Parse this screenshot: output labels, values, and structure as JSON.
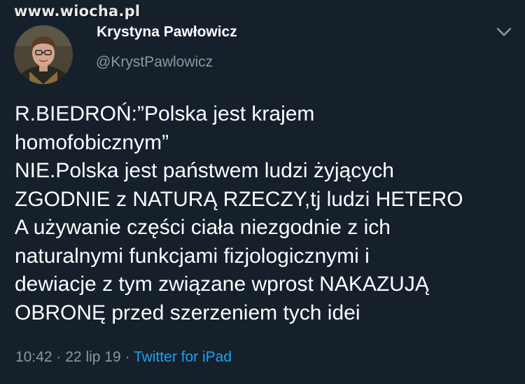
{
  "watermark": "www.wiocha.pl",
  "author": {
    "name": "Krystyna Pawłowicz",
    "handle": "@KrystPawlowicz"
  },
  "tweet": {
    "lines": [
      "R.BIEDROŃ:”Polska jest krajem",
      "homofobicznym”",
      "NIE.Polska jest państwem ludzi żyjących",
      "ZGODNIE z NATURĄ RZECZY,tj ludzi HETERO",
      "A używanie części ciała niezgodnie z ich",
      "naturalnymi funkcjami fizjologicznymi i",
      "dewiacje z tym związane wprost NAKAZUJĄ",
      "OBRONĘ przed szerzeniem tych idei"
    ]
  },
  "meta": {
    "time": "10:42",
    "separator": "·",
    "date": "22 lip 19",
    "source": "Twitter for iPad"
  },
  "icons": {
    "menu": "chevron-down-icon",
    "avatar": "avatar-photo"
  },
  "colors": {
    "background": "#15202b",
    "text": "#ffffff",
    "secondary": "#8899a6",
    "link": "#1da1f2"
  }
}
